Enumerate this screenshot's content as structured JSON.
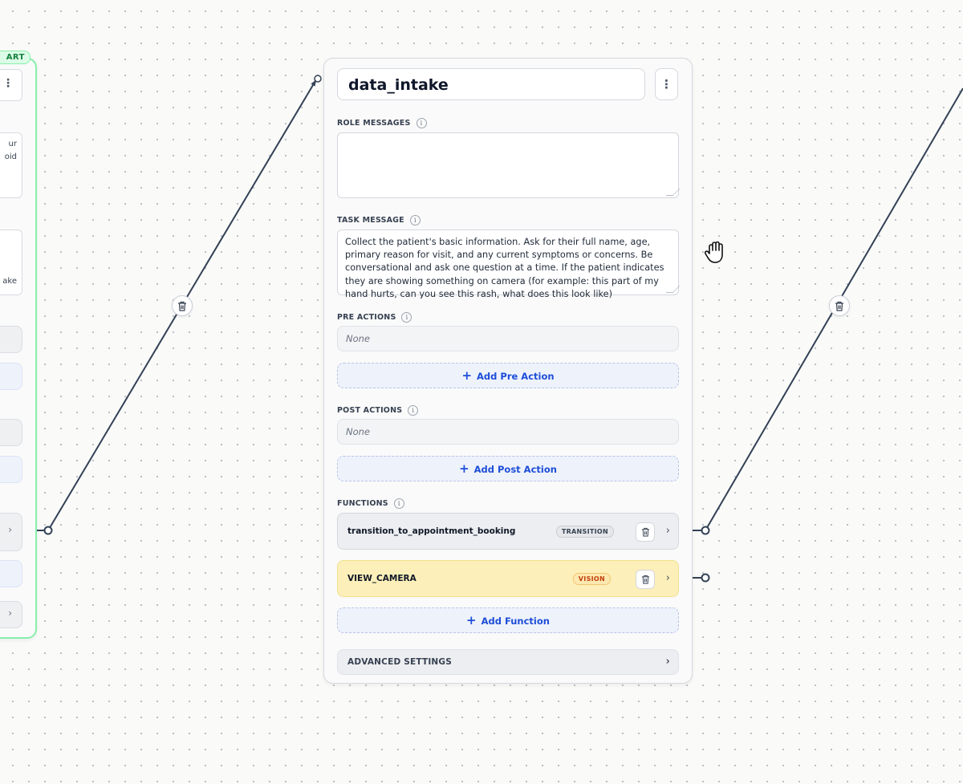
{
  "left_node": {
    "badge": "ART",
    "menu_label": "⋮",
    "text_a": [
      "ur",
      "oid"
    ],
    "text_b": [
      "ake"
    ],
    "chevron": "›"
  },
  "main_node": {
    "title": "data_intake",
    "menu_label": "⋮",
    "role_messages": {
      "label": "ROLE MESSAGES",
      "value": ""
    },
    "task_message": {
      "label": "TASK MESSAGE",
      "value": "Collect the patient's basic information. Ask for their full name, age, primary reason for visit, and any current symptoms or concerns. Be conversational and ask one question at a time. If the patient indicates they are showing something on camera (for example: this part of my hand hurts, can you see this rash, what does this look like)"
    },
    "pre_actions": {
      "label": "PRE ACTIONS",
      "value": "None",
      "add_label": "Add Pre Action"
    },
    "post_actions": {
      "label": "POST ACTIONS",
      "value": "None",
      "add_label": "Add Post Action"
    },
    "functions": {
      "label": "FUNCTIONS",
      "items": [
        {
          "name": "transition_to_appointment_booking",
          "tag": "TRANSITION"
        },
        {
          "name": "VIEW_CAMERA",
          "tag": "VISION"
        }
      ],
      "add_label": "Add Function"
    },
    "advanced_settings": {
      "label": "ADVANCED SETTINGS"
    }
  },
  "icons": {
    "info": "i",
    "plus": "+",
    "chevron": "›",
    "trash": "trash-icon",
    "hand": "grab-hand-icon"
  },
  "colors": {
    "start_border": "#86efac",
    "accent_blue": "#1d4ed8",
    "vision_bg": "#fcefb9",
    "edge": "#334155"
  }
}
